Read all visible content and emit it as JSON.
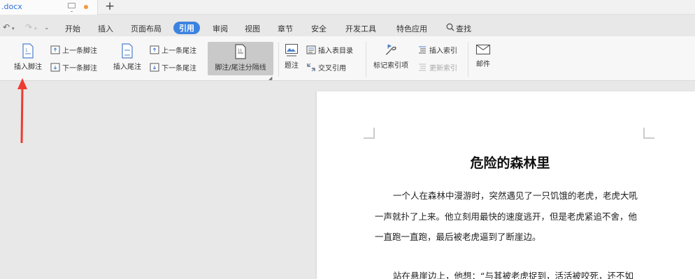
{
  "tab": {
    "title": ".docx"
  },
  "menu": {
    "items": [
      "开始",
      "插入",
      "页面布局",
      "引用",
      "审阅",
      "视图",
      "章节",
      "安全",
      "开发工具",
      "特色应用"
    ],
    "active": "引用",
    "search": "查找"
  },
  "ribbon": {
    "insert_footnote": "插入脚注",
    "prev_footnote": "上一条脚注",
    "next_footnote": "下一条脚注",
    "insert_endnote": "插入尾注",
    "prev_endnote": "上一条尾注",
    "next_endnote": "下一条尾注",
    "separator": "脚注/尾注分隔线",
    "caption": "题注",
    "insert_table_of_figures": "插入表目录",
    "cross_reference": "交叉引用",
    "mark_index": "标记索引项",
    "insert_index": "插入索引",
    "update_index": "更新索引",
    "mail": "邮件"
  },
  "document": {
    "title": "危险的森林里",
    "lines": [
      "一个人在森林中漫游时，突然遇见了一只饥饿的老虎，老虎大吼",
      "一声就扑了上来。他立刻用最快的速度逃开，但是老虎紧追不舍，他",
      "一直跑一直跑，最后被老虎逼到了断崖边。",
      "站在悬崖边上，他想：“与其被老虎捉到，活活被咬死，还不如"
    ]
  },
  "colors": {
    "accent": "#3c83e0",
    "arrow": "#ee3b30"
  }
}
